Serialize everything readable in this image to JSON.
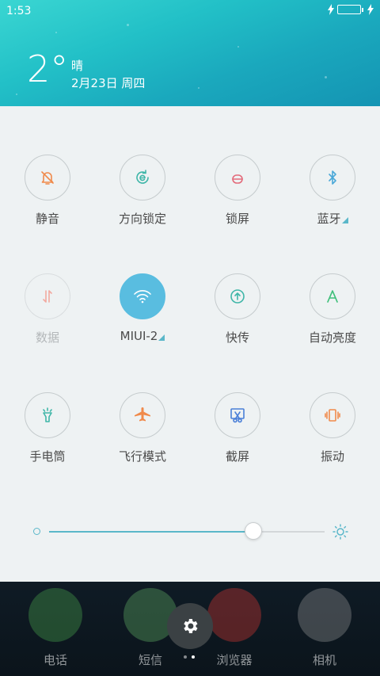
{
  "status": {
    "time": "1:53"
  },
  "weather": {
    "temp": "2°",
    "condition": "晴",
    "date": "2月23日 周四"
  },
  "tiles": [
    {
      "label": "静音",
      "icon": "bell-mute-icon",
      "color": "#f08a4b",
      "active": false,
      "dim": false
    },
    {
      "label": "方向锁定",
      "icon": "rotation-lock-icon",
      "color": "#3fb6a8",
      "active": false,
      "dim": false
    },
    {
      "label": "锁屏",
      "icon": "lock-screen-icon",
      "color": "#e36a7a",
      "active": false,
      "dim": false
    },
    {
      "label": "蓝牙",
      "icon": "bluetooth-icon",
      "color": "#4aa8d8",
      "active": false,
      "dim": false,
      "more": true
    },
    {
      "label": "数据",
      "icon": "mobile-data-icon",
      "color": "#f2a99f",
      "active": false,
      "dim": true
    },
    {
      "label": "MIUI-2",
      "icon": "wifi-icon",
      "color": "#ffffff",
      "active": true,
      "dim": false,
      "more": true
    },
    {
      "label": "快传",
      "icon": "quick-share-icon",
      "color": "#3fb6a8",
      "active": false,
      "dim": false
    },
    {
      "label": "自动亮度",
      "icon": "auto-brightness-icon",
      "color": "#3fbf7a",
      "active": false,
      "dim": false
    },
    {
      "label": "手电筒",
      "icon": "flashlight-icon",
      "color": "#3fb6a8",
      "active": false,
      "dim": false
    },
    {
      "label": "飞行模式",
      "icon": "airplane-icon",
      "color": "#f08a4b",
      "active": false,
      "dim": false
    },
    {
      "label": "截屏",
      "icon": "screenshot-icon",
      "color": "#4a7fd8",
      "active": false,
      "dim": false
    },
    {
      "label": "振动",
      "icon": "vibrate-icon",
      "color": "#f08a4b",
      "active": false,
      "dim": false
    }
  ],
  "brightness": {
    "level": 0.74,
    "accent": "#5ab7c9"
  },
  "dock": {
    "apps": [
      {
        "label": "电话",
        "color": "#4caf50"
      },
      {
        "label": "短信",
        "color": "#66bb6a"
      },
      {
        "label": "浏览器",
        "color": "#e53935"
      },
      {
        "label": "相机",
        "color": "#9e9e9e"
      }
    ]
  },
  "pager": {
    "count": 2,
    "current": 1
  }
}
